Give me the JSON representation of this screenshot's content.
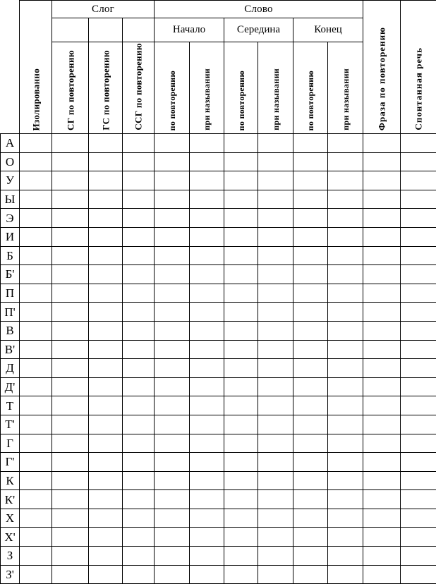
{
  "document": {
    "type": "speech-assessment-table",
    "language": "ru"
  },
  "table": {
    "header": {
      "corner_label": "",
      "isolated_label": "Изолированно",
      "groups": [
        {
          "label": "Слог",
          "span": 3
        },
        {
          "label": "Слово",
          "span": 6
        }
      ],
      "subgroups": [
        {
          "label": "Начало",
          "span": 2
        },
        {
          "label": "Середина",
          "span": 2
        },
        {
          "label": "Конец",
          "span": 2
        }
      ],
      "syllable_columns": [
        "СГ по повторению",
        "ГС по повторению",
        "ССГ по повторению"
      ],
      "word_columns": [
        "по повторению",
        "при назывании",
        "по повторению",
        "при назывании",
        "по повторению",
        "при назывании"
      ],
      "phrase_label": "Фраза по повторению",
      "spontaneous_label": "Спонтанная речь"
    },
    "rows": [
      {
        "label": "А"
      },
      {
        "label": "О"
      },
      {
        "label": "У"
      },
      {
        "label": "Ы"
      },
      {
        "label": "Э"
      },
      {
        "label": "И"
      },
      {
        "label": "Б"
      },
      {
        "label": "Б'"
      },
      {
        "label": "П"
      },
      {
        "label": "П'"
      },
      {
        "label": "В"
      },
      {
        "label": "В'"
      },
      {
        "label": "Д"
      },
      {
        "label": "Д'"
      },
      {
        "label": "Т"
      },
      {
        "label": "Т'"
      },
      {
        "label": "Г"
      },
      {
        "label": "Г'"
      },
      {
        "label": "К"
      },
      {
        "label": "К'"
      },
      {
        "label": "Х"
      },
      {
        "label": "Х'"
      },
      {
        "label": "З"
      },
      {
        "label": "З'"
      }
    ],
    "data_column_count": 12,
    "colors": {
      "border": "#000000",
      "text": "#000000",
      "background": "#ffffff"
    }
  }
}
